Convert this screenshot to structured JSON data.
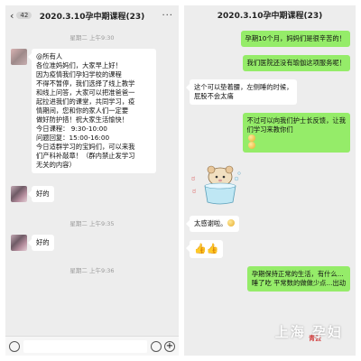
{
  "left": {
    "title": "2020.3.10孕中期课程(23)",
    "unread_badge": "42",
    "timestamps": [
      "星期二 上午9:30",
      "星期二 上午9:35",
      "星期二 上午9:36"
    ],
    "announcement_lines": [
      "@所有人",
      "各位准妈妈们，大家早上好！",
      "      因为疫情我们孕妇学校的课程",
      "不得不暂停，我们选择了线上教学",
      "和线上问答，大家可以把准爸爸一",
      "起拉进我们的课堂，共同学习，疫",
      "情期间，您和你的家人们一定要",
      "做好防护措！祝大家生活愉快！",
      "今日课程：  9:30-10:00",
      "问题回复：15:00-16:00",
      "今日适群学习的宝妈们，可以来我",
      "们产科补敲章！（群内禁止发学习",
      "无关的内容）"
    ],
    "reply1": "好的",
    "reply2": "好的"
  },
  "right": {
    "title": "2020.3.10孕中期课程(23)",
    "messages": [
      {
        "dir": "out",
        "lines": [
          "孕期10个月，妈妈们是很辛苦的！"
        ]
      },
      {
        "dir": "out",
        "lines": [
          "我们医院还没有瑜伽这项服务呢！"
        ]
      },
      {
        "dir": "in",
        "lines": [
          "这个可以垫着腰，左侧睡的时候，",
          "屁股不会太痛"
        ]
      },
      {
        "dir": "out",
        "lines": [
          "不过可以向我们护士长反馈，让我",
          "们学习来教你们"
        ]
      },
      {
        "dir": "in",
        "lines": [
          "太感谢啦。"
        ]
      },
      {
        "dir": "out",
        "lines": [
          "孕期保持正常的生活，有什么...",
          "睡了吃  平常数的做做少点...出动"
        ]
      }
    ],
    "watermark": "上海 孕妇",
    "seal": "青云"
  },
  "colors": {
    "chat_bg": "#ededed",
    "bubble_out": "#95ec69",
    "bubble_in": "#ffffff"
  }
}
